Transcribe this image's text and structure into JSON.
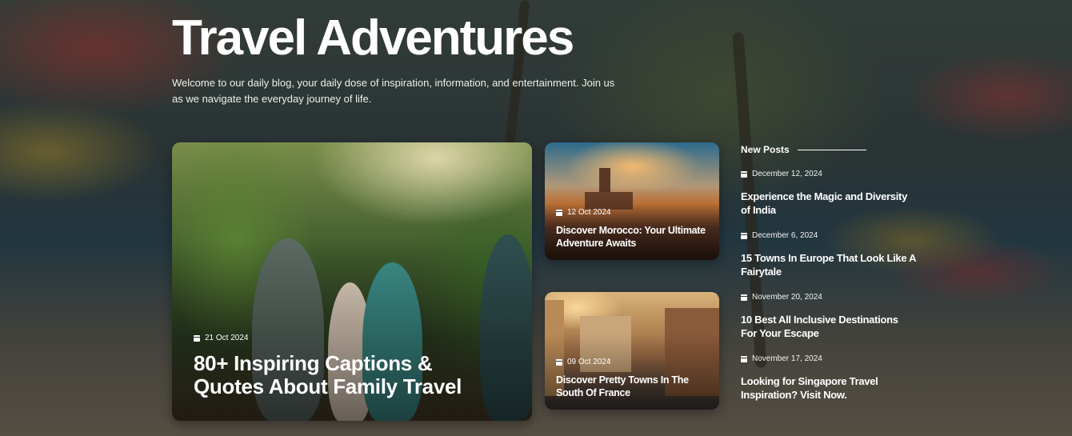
{
  "header": {
    "title": "Travel Adventures",
    "description": "Welcome to our daily blog, your daily dose of inspiration, information, and entertainment. Join us as we navigate the everyday journey of life."
  },
  "featured": {
    "main": {
      "date": "21 Oct 2024",
      "title": "80+ Inspiring Captions & Quotes About Family Travel"
    },
    "cards": [
      {
        "date": "12 Oct 2024",
        "title": "Discover Morocco: Your Ultimate Adventure Awaits"
      },
      {
        "date": "09 Oct 2024",
        "title": "Discover Pretty Towns In The South Of France"
      }
    ]
  },
  "sidebar": {
    "heading": "New Posts",
    "posts": [
      {
        "date": "December 12, 2024",
        "title": "Experience the Magic and Diversity of India"
      },
      {
        "date": "December 6, 2024",
        "title": "15 Towns In Europe That Look Like A Fairytale"
      },
      {
        "date": "November 20, 2024",
        "title": "10 Best All Inclusive Destinations For Your Escape"
      },
      {
        "date": "November 17, 2024",
        "title": "Looking for Singapore Travel Inspiration? Visit Now."
      }
    ]
  },
  "icons": {
    "date": "calendar-icon"
  }
}
